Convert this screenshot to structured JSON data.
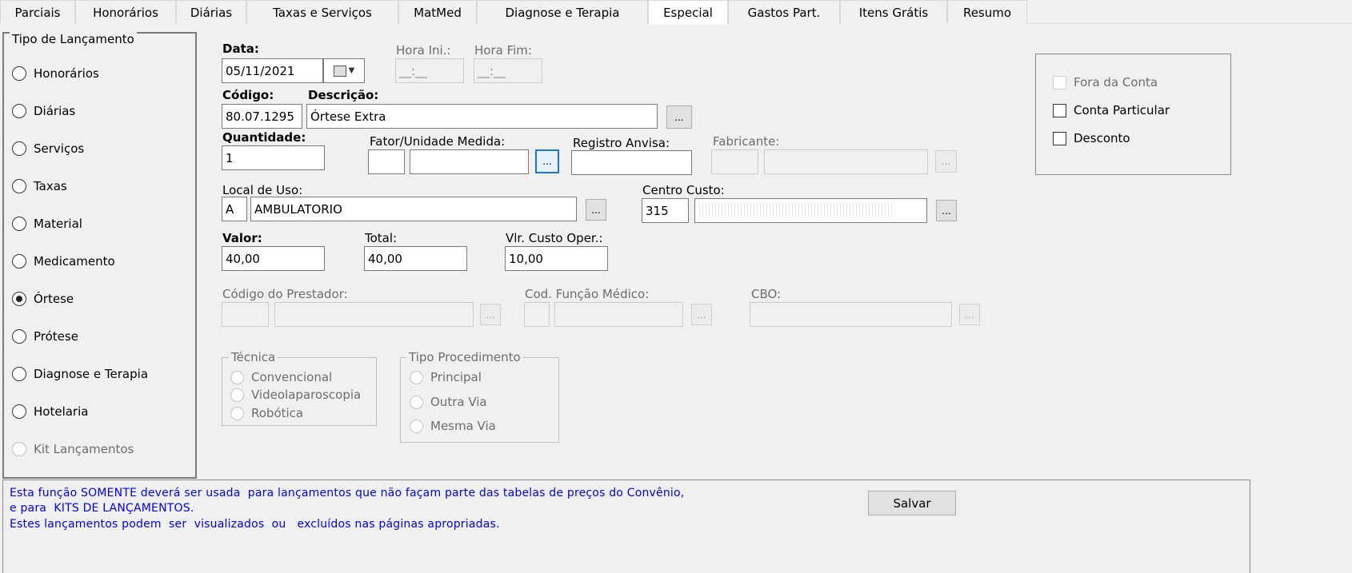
{
  "tabs": [
    "Parciais",
    "Honorários",
    "Diárias",
    "Taxas e Serviços",
    "MatMed",
    "Diagnose e Terapia",
    "Especial",
    "Gastos Part.",
    "Itens Grátis",
    "Resumo"
  ],
  "active_tab": "Especial",
  "tipo_lancamento": {
    "legend": "Tipo de Lançamento",
    "options": [
      "Honorários",
      "Diárias",
      "Serviços",
      "Taxas",
      "Material",
      "Medicamento",
      "Órtese",
      "Prótese",
      "Diagnose e Terapia",
      "Hotelaria",
      "Kit Lançamentos"
    ],
    "selected": "Órtese"
  },
  "form": {
    "data_label": "Data:",
    "data_value": "05/11/2021",
    "hora_ini_label": "Hora Ini.:",
    "hora_ini_value": "__:__",
    "hora_fim_label": "Hora Fim:",
    "hora_fim_value": "__:__",
    "codigo_label": "Código:",
    "codigo_value": "80.07.1295",
    "descricao_label": "Descrição:",
    "descricao_value": "Órtese Extra",
    "quantidade_label": "Quantidade:",
    "quantidade_value": "1",
    "fator_label": "Fator/Unidade Medida:",
    "fator_value": "",
    "unidade_value": "",
    "registro_label": "Registro Anvisa:",
    "registro_value": "",
    "fabricante_label": "Fabricante:",
    "local_label": "Local de Uso:",
    "local_code": "A",
    "local_value": "AMBULATORIO",
    "centro_label": "Centro Custo:",
    "centro_code": "315",
    "valor_label": "Valor:",
    "valor_value": "40,00",
    "total_label": "Total:",
    "total_value": "40,00",
    "custo_label": "Vlr. Custo Oper.:",
    "custo_value": "10,00",
    "prestador_label": "Código do Prestador:",
    "funcao_label": "Cod. Função Médico:",
    "cbo_label": "CBO:",
    "ellipsis": "..."
  },
  "flags": {
    "fora_conta": "Fora da Conta",
    "conta_particular": "Conta Particular",
    "desconto": "Desconto"
  },
  "tecnica": {
    "legend": "Técnica",
    "options": [
      "Convencional",
      "Videolaparoscopia",
      "Robótica"
    ]
  },
  "tipo_procedimento": {
    "legend": "Tipo Procedimento",
    "options": [
      "Principal",
      "Outra Via",
      "Mesma Via"
    ]
  },
  "footer": {
    "line1": "Esta função SOMENTE deverá ser usada  para lançamentos que não façam parte das tabelas de preços do Convênio,",
    "line2": "e para  KITS DE LANÇAMENTOS.",
    "line3": "Estes lançamentos podem  ser  visualizados  ou   excluídos nas páginas apropriadas.",
    "save_label": "Salvar"
  },
  "colors": {
    "background": "#f0f0f0",
    "info_text": "#0000ff",
    "focus_border": "#1e73d6"
  }
}
